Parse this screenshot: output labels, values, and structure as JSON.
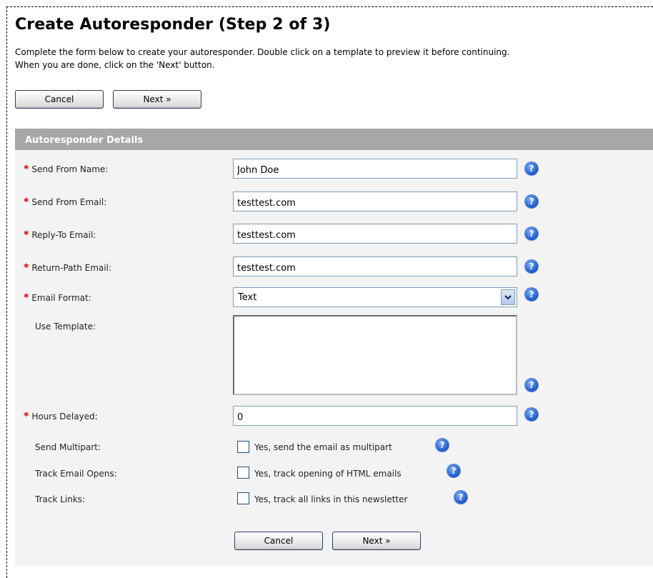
{
  "page": {
    "title": "Create Autoresponder (Step 2 of 3)",
    "intro_line1": "Complete the form below to create your autoresponder. Double click on a template to preview it before continuing.",
    "intro_line2": "When you are done, click on the 'Next' button."
  },
  "buttons": {
    "cancel": "Cancel",
    "next": "Next »"
  },
  "panel": {
    "header": "Autoresponder Details"
  },
  "fields": {
    "send_from_name": {
      "label": "Send From Name:",
      "value": "John Doe"
    },
    "send_from_email": {
      "label": "Send From Email:",
      "value": "testtest.com"
    },
    "reply_to_email": {
      "label": "Reply-To Email:",
      "value": "testtest.com"
    },
    "return_path_email": {
      "label": "Return-Path Email:",
      "value": "testtest.com"
    },
    "email_format": {
      "label": "Email Format:",
      "value": "Text"
    },
    "use_template": {
      "label": "Use Template:"
    },
    "hours_delayed": {
      "label": "Hours Delayed:",
      "value": "0"
    },
    "send_multipart": {
      "label": "Send Multipart:",
      "option": "Yes, send the email as multipart"
    },
    "track_opens": {
      "label": "Track Email Opens:",
      "option": "Yes, track opening of HTML emails"
    },
    "track_links": {
      "label": "Track Links:",
      "option": "Yes, track all links in this newsletter"
    }
  },
  "symbols": {
    "required": "*",
    "help": "?"
  },
  "icons": {
    "help": "help-icon",
    "dropdown": "chevron-down-icon"
  },
  "colors": {
    "panel_header": "#a7a7a7",
    "panel_bg": "#f3f3f3",
    "required": "#d40000",
    "help": "#1a56c9"
  }
}
